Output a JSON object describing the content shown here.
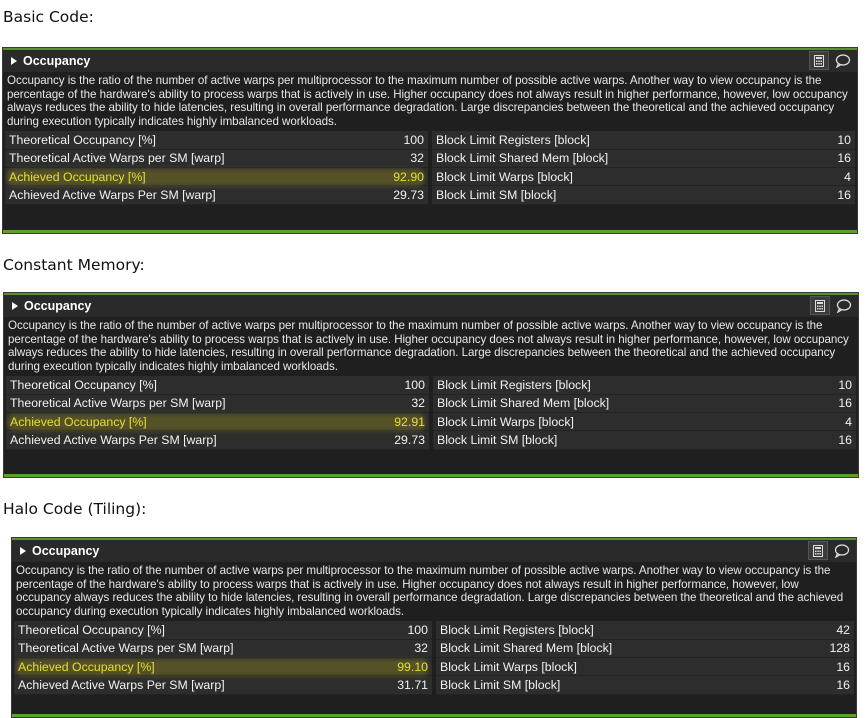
{
  "colors": {
    "panel_bg": "#1f1f1f",
    "row_bg": "#2d2d2d",
    "accent_green": "#59a22c",
    "highlight_yellow": "#f3ee3a"
  },
  "sections": [
    {
      "caption": "Basic Code:",
      "panel": {
        "title": "Occupancy",
        "icons": [
          "calculator-icon",
          "comment-icon"
        ],
        "description": "Occupancy is the ratio of the number of active warps per multiprocessor to the maximum number of possible active warps. Another way to view occupancy is the percentage of the hardware's ability to process warps that is actively in use. Higher occupancy does not always result in higher performance, however, low occupancy always reduces the ability to hide latencies, resulting in overall performance degradation. Large discrepancies between the theoretical and the achieved occupancy during execution typically indicates highly imbalanced workloads.",
        "left": [
          {
            "label": "Theoretical Occupancy [%]",
            "value": "100"
          },
          {
            "label": "Theoretical Active Warps per SM [warp]",
            "value": "32"
          },
          {
            "label": "Achieved Occupancy [%]",
            "value": "92.90"
          },
          {
            "label": "Achieved Active Warps Per SM [warp]",
            "value": "29.73"
          }
        ],
        "right": [
          {
            "label": "Block Limit Registers [block]",
            "value": "10"
          },
          {
            "label": "Block Limit Shared Mem [block]",
            "value": "16"
          },
          {
            "label": "Block Limit Warps [block]",
            "value": "4"
          },
          {
            "label": "Block Limit SM [block]",
            "value": "16"
          }
        ]
      }
    },
    {
      "caption": "Constant Memory:",
      "panel": {
        "title": "Occupancy",
        "icons": [
          "calculator-icon",
          "comment-icon"
        ],
        "description": "Occupancy is the ratio of the number of active warps per multiprocessor to the maximum number of possible active warps. Another way to view occupancy is the percentage of the hardware's ability to process warps that is actively in use. Higher occupancy does not always result in higher performance, however, low occupancy always reduces the ability to hide latencies, resulting in overall performance degradation. Large discrepancies between the theoretical and the achieved occupancy during execution typically indicates highly imbalanced workloads.",
        "left": [
          {
            "label": "Theoretical Occupancy [%]",
            "value": "100"
          },
          {
            "label": "Theoretical Active Warps per SM [warp]",
            "value": "32"
          },
          {
            "label": "Achieved Occupancy [%]",
            "value": "92.91"
          },
          {
            "label": "Achieved Active Warps Per SM [warp]",
            "value": "29.73"
          }
        ],
        "right": [
          {
            "label": "Block Limit Registers [block]",
            "value": "10"
          },
          {
            "label": "Block Limit Shared Mem [block]",
            "value": "16"
          },
          {
            "label": "Block Limit Warps [block]",
            "value": "4"
          },
          {
            "label": "Block Limit SM [block]",
            "value": "16"
          }
        ]
      }
    },
    {
      "caption": "Halo Code (Tiling):",
      "panel": {
        "title": "Occupancy",
        "icons": [
          "calculator-icon",
          "comment-icon"
        ],
        "description": "Occupancy is the ratio of the number of active warps per multiprocessor to the maximum number of possible active warps. Another way to view occupancy is the percentage of the hardware's ability to process warps that is actively in use. Higher occupancy does not always result in higher performance, however, low occupancy always reduces the ability to hide latencies, resulting in overall performance degradation. Large discrepancies between the theoretical and the achieved occupancy during execution typically indicates highly imbalanced workloads.",
        "left": [
          {
            "label": "Theoretical Occupancy [%]",
            "value": "100"
          },
          {
            "label": "Theoretical Active Warps per SM [warp]",
            "value": "32"
          },
          {
            "label": "Achieved Occupancy [%]",
            "value": "99.10"
          },
          {
            "label": "Achieved Active Warps Per SM [warp]",
            "value": "31.71"
          }
        ],
        "right": [
          {
            "label": "Block Limit Registers [block]",
            "value": "42"
          },
          {
            "label": "Block Limit Shared Mem [block]",
            "value": "128"
          },
          {
            "label": "Block Limit Warps [block]",
            "value": "16"
          },
          {
            "label": "Block Limit SM [block]",
            "value": "16"
          }
        ]
      }
    }
  ]
}
